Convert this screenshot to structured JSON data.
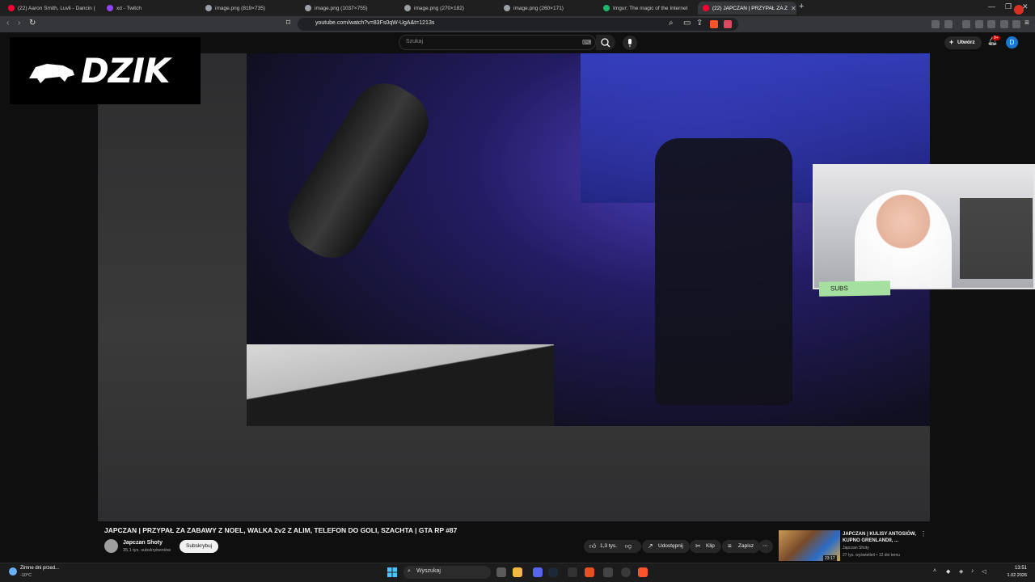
{
  "browser": {
    "tabs": [
      {
        "label": "(22) Aaron Smith, Luvli - Dancin (",
        "favicon": "youtube-icon",
        "color": "#ff0033"
      },
      {
        "label": "xd - Twitch",
        "favicon": "twitch-icon",
        "color": "#9146ff"
      },
      {
        "label": "image.png (819×735)",
        "favicon": "globe-icon",
        "color": "#9aa0a6"
      },
      {
        "label": "image.png (1037×755)",
        "favicon": "globe-icon",
        "color": "#9aa0a6"
      },
      {
        "label": "image.png (270×182)",
        "favicon": "globe-icon",
        "color": "#9aa0a6"
      },
      {
        "label": "image.png (260×171)",
        "favicon": "globe-icon",
        "color": "#9aa0a6"
      },
      {
        "label": "Imgur: The magic of the Internet",
        "favicon": "imgur-icon",
        "color": "#1bb76e"
      },
      {
        "label": "(22) JAPCZAN | PRZYPAŁ ZA Z",
        "favicon": "youtube-icon",
        "color": "#ff0033",
        "active": true
      }
    ],
    "new_tab": "+",
    "url": "youtube.com/watch?v=83Fs0qW-UgA&t=1213s"
  },
  "youtube": {
    "search_placeholder": "Szukaj",
    "create_label": "Utwórz",
    "notification_count": "9+",
    "avatar_letter": "D"
  },
  "overlay": {
    "logo_text": "DZIK",
    "webcam_tag": "SUBS"
  },
  "video": {
    "title": "JAPCZAN | PRZYPAŁ ZA ZABAWY Z NOEL, WALKA 2v2 Z ALIM, TELEFON DO GOLI, SZACHTA | GTA RP #87",
    "channel_name": "Japczan Shoty",
    "channel_subs": "35,1 tys. subskrybentów",
    "subscribe_label": "Subskrybuj",
    "likes": "1,3 tys.",
    "share_label": "Udostępnij",
    "clip_label": "Klip",
    "save_label": "Zapisz",
    "more_label": "⋯"
  },
  "recommendation": {
    "title": "JAPCZAN | KULISY ANTOSIÓW, KUPNO GRENLANDII, ...",
    "channel": "Japczan Shoty",
    "meta": "27 tys. wyświetleń • 12 dni temu",
    "duration": "23:17"
  },
  "taskbar": {
    "weather_text": "Zimne dni przed...",
    "weather_temp": "-10°C",
    "search_placeholder": "Wyszukaj",
    "time": "13:51",
    "date": "1.02.2026"
  }
}
